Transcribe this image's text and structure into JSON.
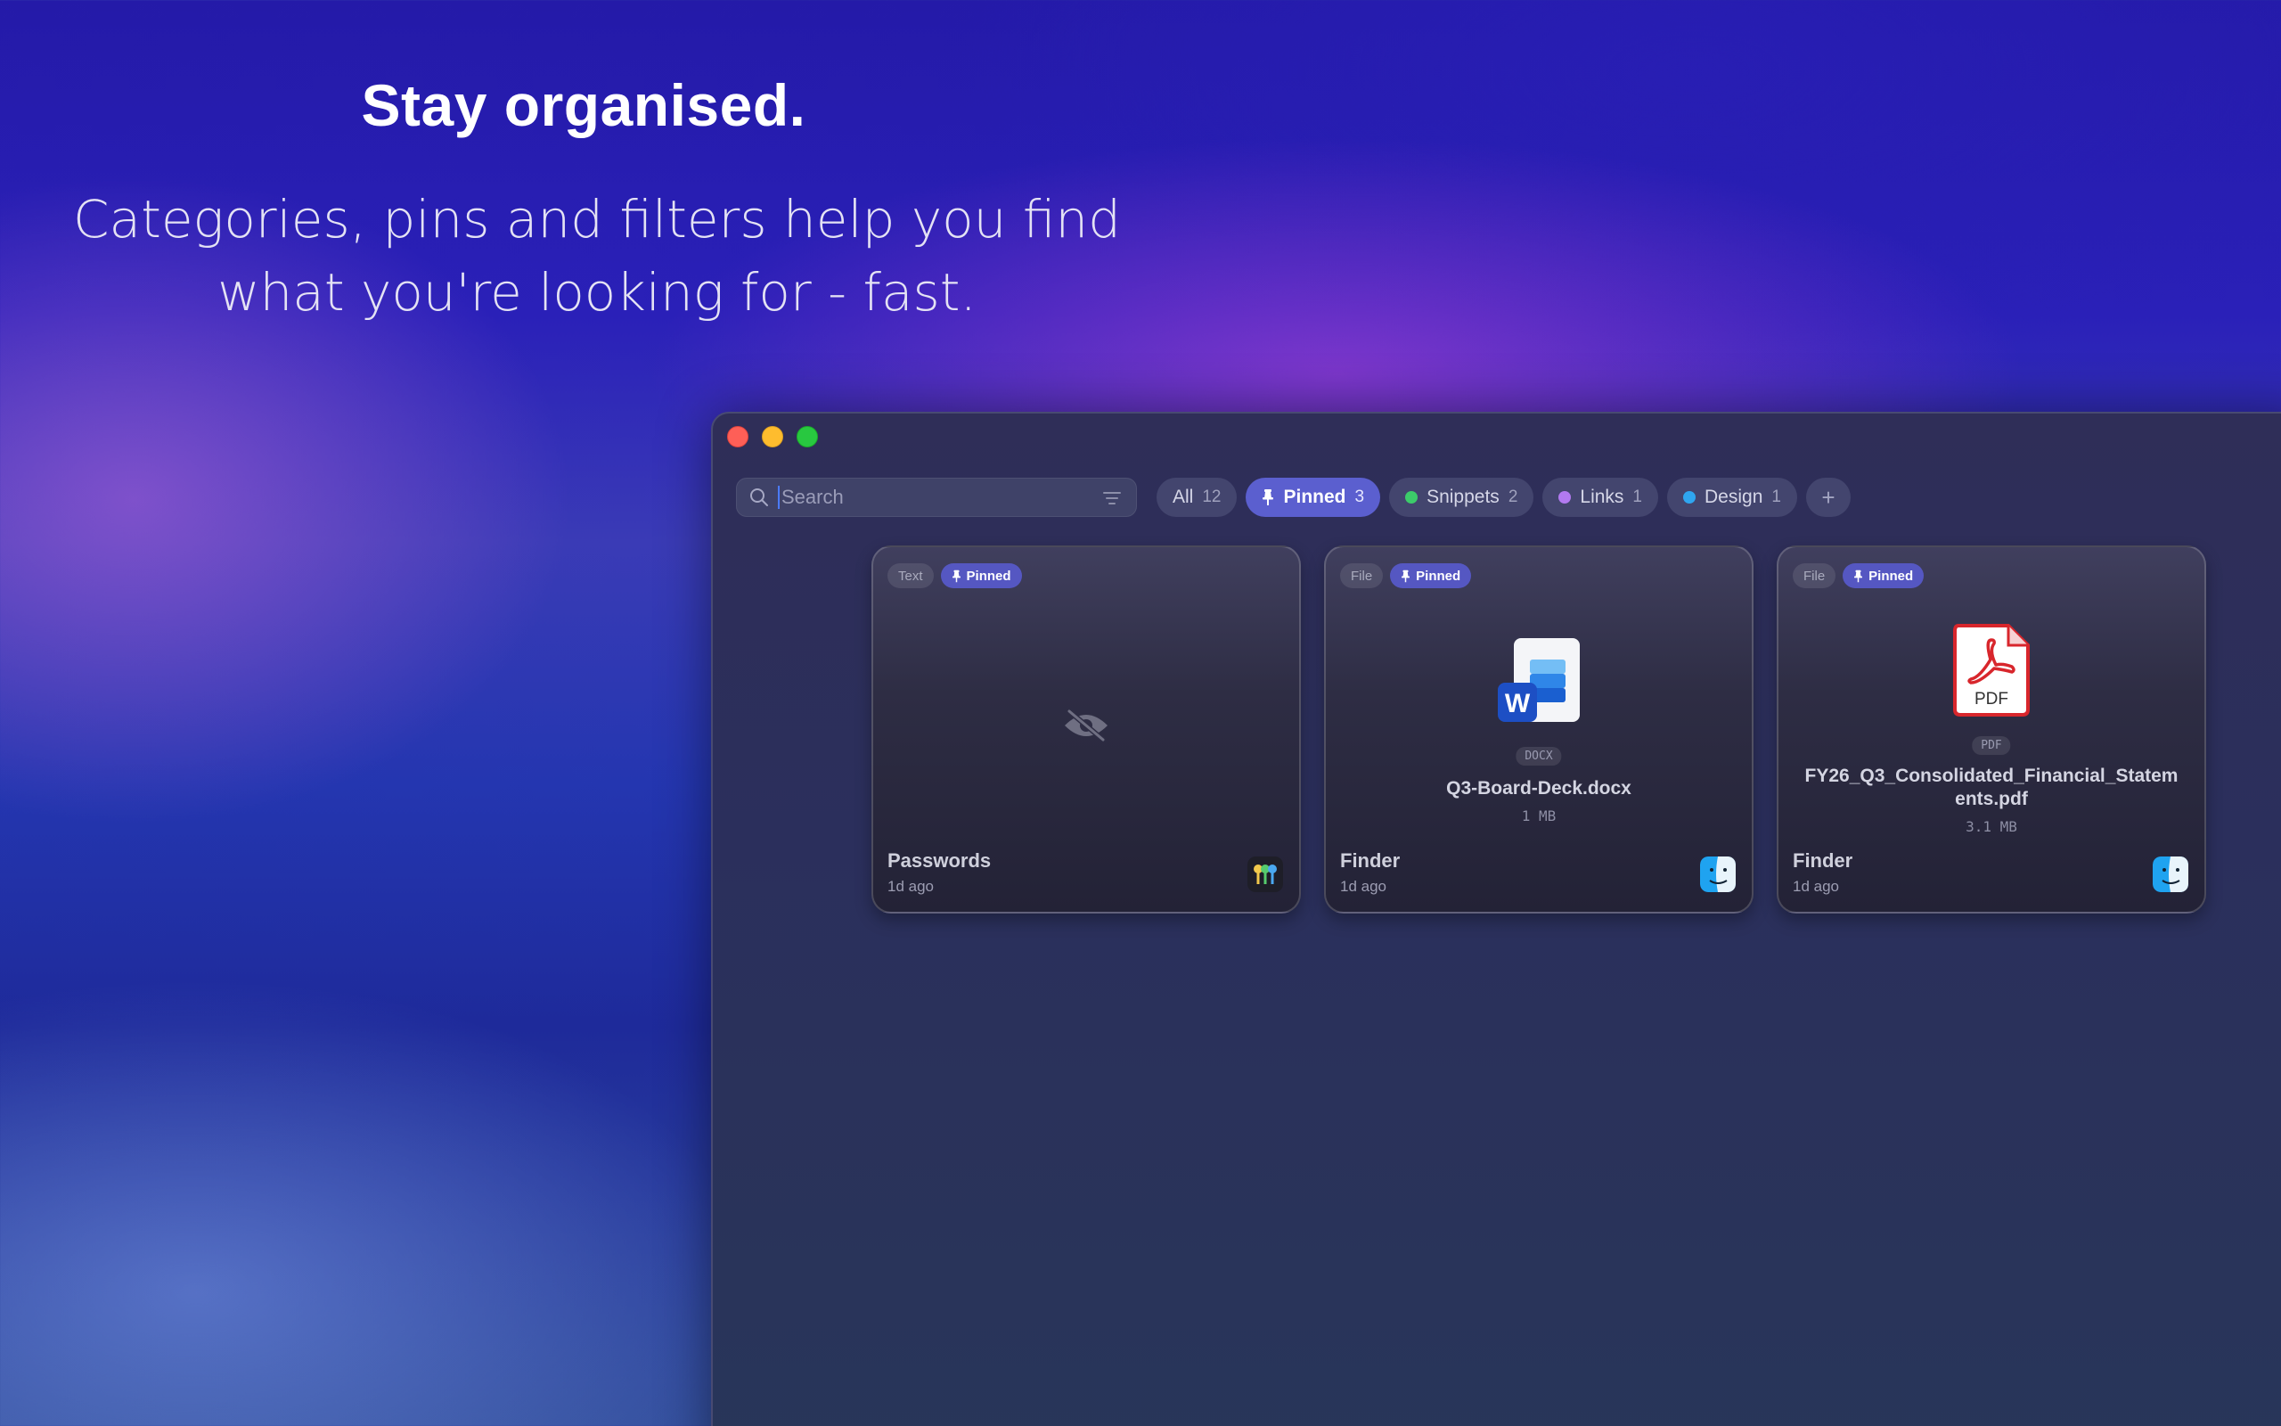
{
  "hero": {
    "title": "Stay organised.",
    "subtitle_line1": "Categories, pins and filters help you find",
    "subtitle_line2": "what you're looking for - fast."
  },
  "window": {
    "traffic_lights": [
      "close",
      "minimize",
      "zoom"
    ]
  },
  "search": {
    "placeholder": "Search",
    "value": ""
  },
  "filters": [
    {
      "label": "All",
      "count": "12",
      "active": false
    },
    {
      "label": "Pinned",
      "count": "3",
      "active": true,
      "icon": "pin-icon"
    },
    {
      "label": "Snippets",
      "count": "2",
      "active": false,
      "color": "#3ccb6a"
    },
    {
      "label": "Links",
      "count": "1",
      "active": false,
      "color": "#b27af0"
    },
    {
      "label": "Design",
      "count": "1",
      "active": false,
      "color": "#2fa6f0"
    }
  ],
  "add_filter_label": "+",
  "cards": [
    {
      "type": "Text",
      "pinned_label": "Pinned",
      "source": "Passwords",
      "time": "1d ago",
      "content_icon": "hidden-eye-icon",
      "app_icon": "passwords-app-icon"
    },
    {
      "type": "File",
      "pinned_label": "Pinned",
      "file_type": "DOCX",
      "file_name": "Q3-Board-Deck.docx",
      "file_size": "1 MB",
      "source": "Finder",
      "time": "1d ago",
      "content_icon": "word-document-icon",
      "app_icon": "finder-app-icon"
    },
    {
      "type": "File",
      "pinned_label": "Pinned",
      "file_type": "PDF",
      "file_name": "FY26_Q3_Consolidated_Financial_Statements.pdf",
      "file_size": "3.1 MB",
      "pdf_icon_text": "PDF",
      "source": "Finder",
      "time": "1d ago",
      "content_icon": "pdf-document-icon",
      "app_icon": "finder-app-icon"
    }
  ]
}
